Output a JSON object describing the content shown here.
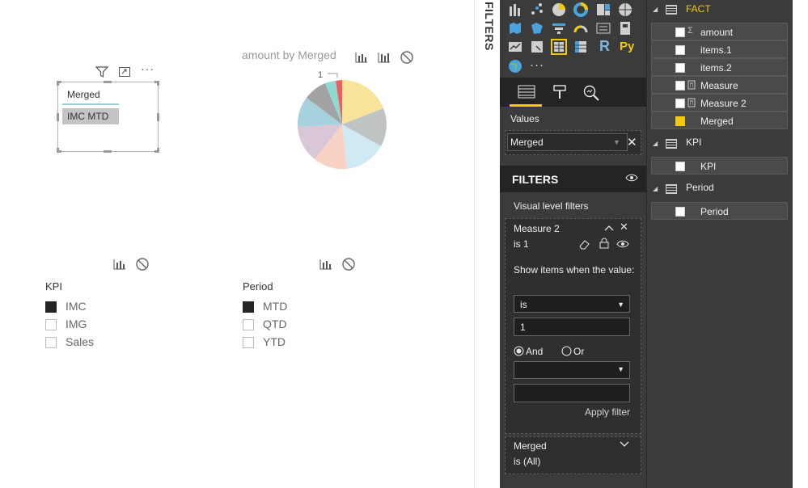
{
  "filters_pane_title": "FILTERS",
  "table_visual": {
    "header": "Merged",
    "row_value": "IMC MTD"
  },
  "pie": {
    "title": "amount by Merged",
    "label": "1"
  },
  "slicers": [
    {
      "title": "KPI",
      "items": [
        {
          "label": "IMC",
          "checked": true
        },
        {
          "label": "IMG",
          "checked": false
        },
        {
          "label": "Sales",
          "checked": false
        }
      ]
    },
    {
      "title": "Period",
      "items": [
        {
          "label": "MTD",
          "checked": true
        },
        {
          "label": "QTD",
          "checked": false
        },
        {
          "label": "YTD",
          "checked": false
        }
      ]
    }
  ],
  "visualizations": {
    "values_label": "Values",
    "values_field": "Merged",
    "filters_header": "FILTERS",
    "visual_level_label": "Visual level filters",
    "filter_card": {
      "title": "Measure 2",
      "summary": "is 1",
      "show_items_label": "Show items when the value:",
      "operator": "is",
      "value": "1",
      "and_label": "And",
      "or_label": "Or",
      "apply_label": "Apply filter"
    },
    "merged_card": {
      "title": "Merged",
      "summary": "is (All)"
    },
    "r_label": "R",
    "py_label": "Py"
  },
  "fields": {
    "tables": [
      {
        "name": "FACT",
        "fields": [
          {
            "name": "amount",
            "checked": false,
            "icon": "sigma-icon"
          },
          {
            "name": "items.1",
            "checked": false,
            "icon": ""
          },
          {
            "name": "items.2",
            "checked": false,
            "icon": ""
          },
          {
            "name": "Measure",
            "checked": false,
            "icon": "calculator-icon"
          },
          {
            "name": "Measure 2",
            "checked": false,
            "icon": "calculator-icon"
          },
          {
            "name": "Merged",
            "checked": true,
            "icon": ""
          }
        ]
      },
      {
        "name": "KPI",
        "fields": [
          {
            "name": "KPI",
            "checked": false,
            "icon": ""
          }
        ]
      },
      {
        "name": "Period",
        "fields": [
          {
            "name": "Period",
            "checked": false,
            "icon": ""
          }
        ]
      }
    ]
  },
  "colors": {
    "accent_yellow": "#f2c811",
    "pane_bg": "#3b3b3b"
  }
}
